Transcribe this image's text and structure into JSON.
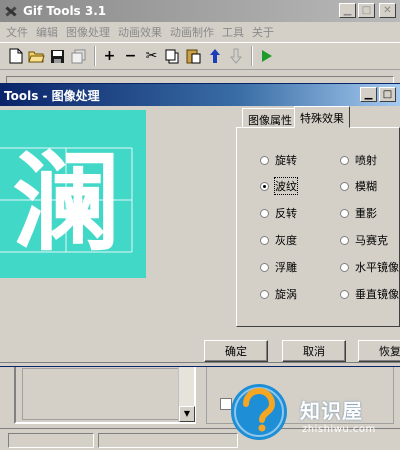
{
  "main_window": {
    "title": "Gif Tools 3.1",
    "menu": [
      "文件",
      "编辑",
      "图像处理",
      "动画效果",
      "动画制作",
      "工具",
      "关于"
    ],
    "toolbar_icons": [
      "new-file-icon",
      "open-folder-icon",
      "save-icon",
      "copy-frames-icon",
      "add-icon",
      "remove-icon",
      "cut-icon",
      "copy-icon",
      "paste-icon",
      "move-up-icon",
      "move-down-icon",
      "play-icon"
    ]
  },
  "dialog": {
    "title": "Tools - 图像处理",
    "preview_char": "澜",
    "preview_bg": "#42d8c8",
    "tabs": [
      "图像属性",
      "特殊效果"
    ],
    "active_tab": "特殊效果",
    "effects_left": [
      "旋转",
      "波纹",
      "反转",
      "灰度",
      "浮雕",
      "旋涡"
    ],
    "effects_right": [
      "喷射",
      "模糊",
      "重影",
      "马赛克",
      "水平镜像",
      "垂直镜像"
    ],
    "selected_effect": "波纹",
    "buttons": {
      "ok": "确定",
      "cancel": "取消",
      "restore": "恢复"
    }
  },
  "watermark": {
    "name": "知识屋",
    "url": "zhishiwu.com"
  },
  "colors": {
    "dialog_title_start": "#0a246a",
    "dialog_title_end": "#a6caf0",
    "window_face": "#d4d0c8",
    "watermark_blue": "#1e8fd6"
  }
}
